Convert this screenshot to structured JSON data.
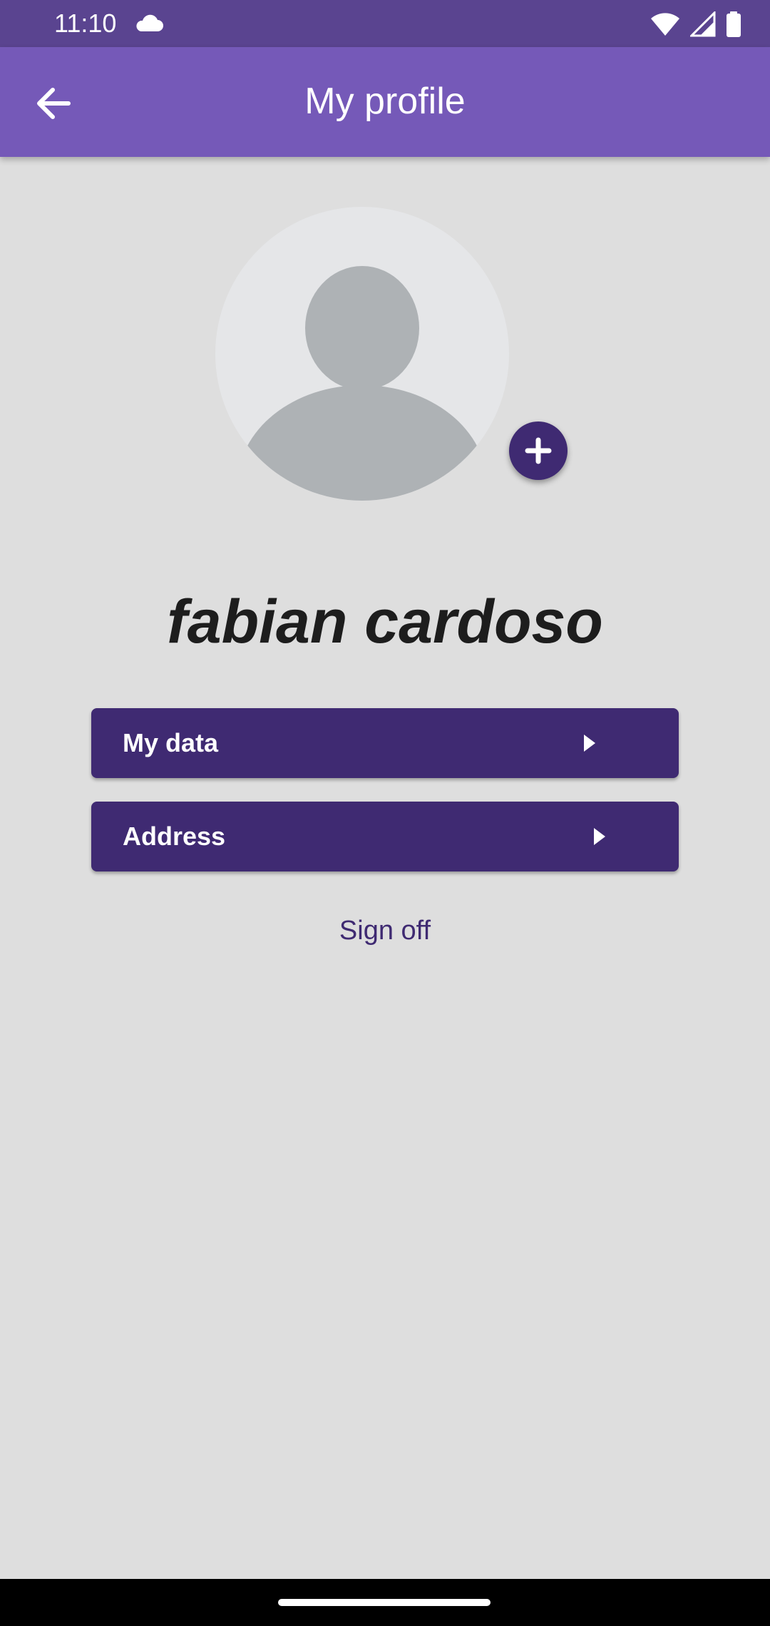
{
  "status_bar": {
    "time": "11:10",
    "icons": [
      "cloud-icon",
      "wifi-icon",
      "signal-icon",
      "battery-icon"
    ]
  },
  "app_bar": {
    "title": "My profile",
    "back_icon": "arrow-left-icon",
    "background": "#7559b8"
  },
  "profile": {
    "avatar_icon": "person-placeholder-icon",
    "add_photo_icon": "plus-icon",
    "name": "fabian cardoso"
  },
  "menu": {
    "items": [
      {
        "label": "My data",
        "icon": "caret-right-icon"
      },
      {
        "label": "Address",
        "icon": "caret-right-icon"
      }
    ],
    "color": "#3f2a72"
  },
  "sign_off": {
    "label": "Sign off"
  }
}
